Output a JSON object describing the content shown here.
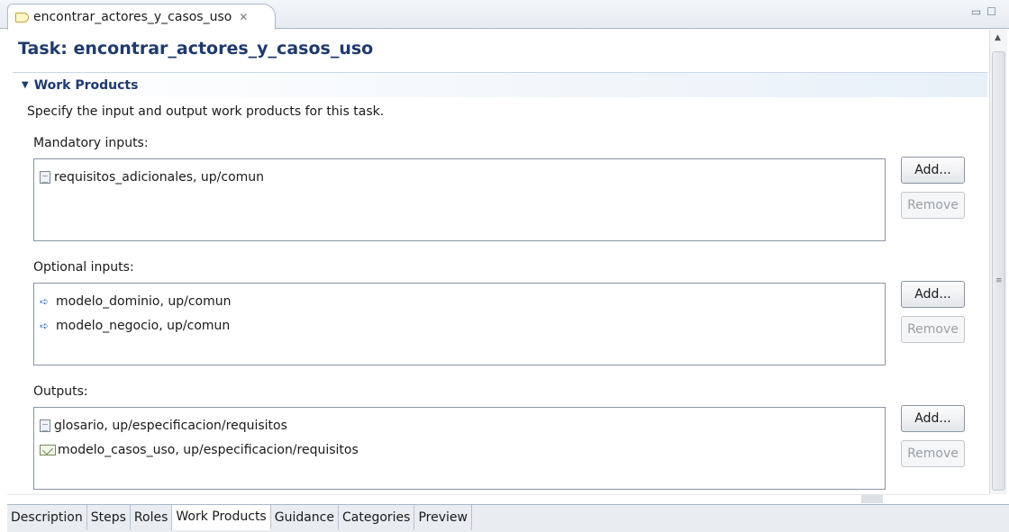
{
  "editor_tab": {
    "title": "encontrar_actores_y_casos_uso",
    "close_glyph": "✕"
  },
  "window_controls": {
    "minimize": "▭",
    "maximize": "☐"
  },
  "form": {
    "title": "Task: encontrar_actores_y_casos_uso",
    "section": {
      "title": "Work Products",
      "description": "Specify the input and output work products for this task."
    }
  },
  "groups": [
    {
      "label": "Mandatory inputs:",
      "items": [
        {
          "icon": "document-icon",
          "text": "requisitos_adicionales, up/comun"
        }
      ],
      "add_label": "Add...",
      "remove_label": "Remove"
    },
    {
      "label": "Optional inputs:",
      "items": [
        {
          "icon": "artifact-arrow-icon",
          "text": "modelo_dominio, up/comun"
        },
        {
          "icon": "artifact-arrow-icon",
          "text": "modelo_negocio, up/comun"
        }
      ],
      "add_label": "Add...",
      "remove_label": "Remove"
    },
    {
      "label": "Outputs:",
      "items": [
        {
          "icon": "document-icon",
          "text": "glosario, up/especificacion/requisitos"
        },
        {
          "icon": "model-icon",
          "text": "modelo_casos_uso, up/especificacion/requisitos"
        }
      ],
      "add_label": "Add...",
      "remove_label": "Remove"
    }
  ],
  "page_tabs": [
    {
      "label": "Description",
      "active": false
    },
    {
      "label": "Steps",
      "active": false
    },
    {
      "label": "Roles",
      "active": false
    },
    {
      "label": "Work Products",
      "active": true
    },
    {
      "label": "Guidance",
      "active": false
    },
    {
      "label": "Categories",
      "active": false
    },
    {
      "label": "Preview",
      "active": false
    }
  ],
  "colors": {
    "title": "#1f3a6e",
    "tab_border": "#a9b8cc",
    "disabled_text": "#9aa0a6"
  }
}
